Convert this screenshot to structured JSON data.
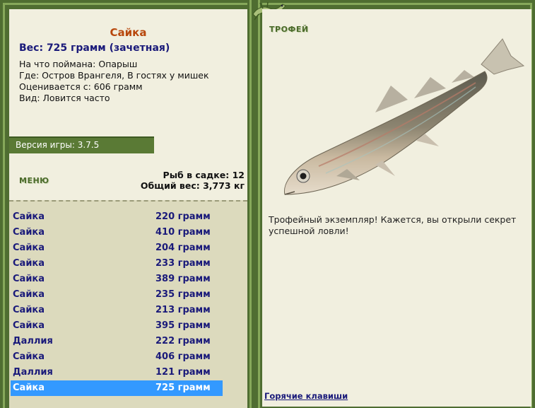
{
  "catch": {
    "name": "Сайка",
    "weight_line": "Вес: 725 грамм (зачетная)",
    "bait_line": "На что поймана: Опарыш",
    "location_line": "Где: Остров Врангеля, В гостях у мишек",
    "value_line": "Оценивается с: 606 грамм",
    "species_line": "Вид: Ловится часто"
  },
  "version": "Версия игры: 3.7.5",
  "menu": {
    "label": "МЕНЮ"
  },
  "stats": {
    "fish_count": "Рыб в садке: 12",
    "total_weight": "Общий вес: 3,773 кг"
  },
  "fish_list": [
    {
      "name": "Сайка",
      "weight": "220 грамм"
    },
    {
      "name": "Сайка",
      "weight": "410 грамм"
    },
    {
      "name": "Сайка",
      "weight": "204 грамм"
    },
    {
      "name": "Сайка",
      "weight": "233 грамм"
    },
    {
      "name": "Сайка",
      "weight": "389 грамм"
    },
    {
      "name": "Сайка",
      "weight": "235 грамм"
    },
    {
      "name": "Сайка",
      "weight": "213 грамм"
    },
    {
      "name": "Сайка",
      "weight": "395 грамм"
    },
    {
      "name": "Даллия",
      "weight": "222 грамм"
    },
    {
      "name": "Сайка",
      "weight": "406 грамм"
    },
    {
      "name": "Даллия",
      "weight": "121 грамм"
    },
    {
      "name": "Сайка",
      "weight": "725 грамм"
    }
  ],
  "selected_index": 11,
  "trophy": {
    "label": "ТРОФЕЙ",
    "message": "Трофейный экземпляр! Кажется, вы открыли секрет успешной ловли!",
    "image": "fish-illustration"
  },
  "hotkeys_link": "Горячие клавиши",
  "colors": {
    "frame": "#5f7d3c",
    "panel": "#f1efdf",
    "list_bg": "#dcdabd",
    "link": "#1a1a7a",
    "fish_name": "#b8470c",
    "selected": "#3399ff"
  }
}
